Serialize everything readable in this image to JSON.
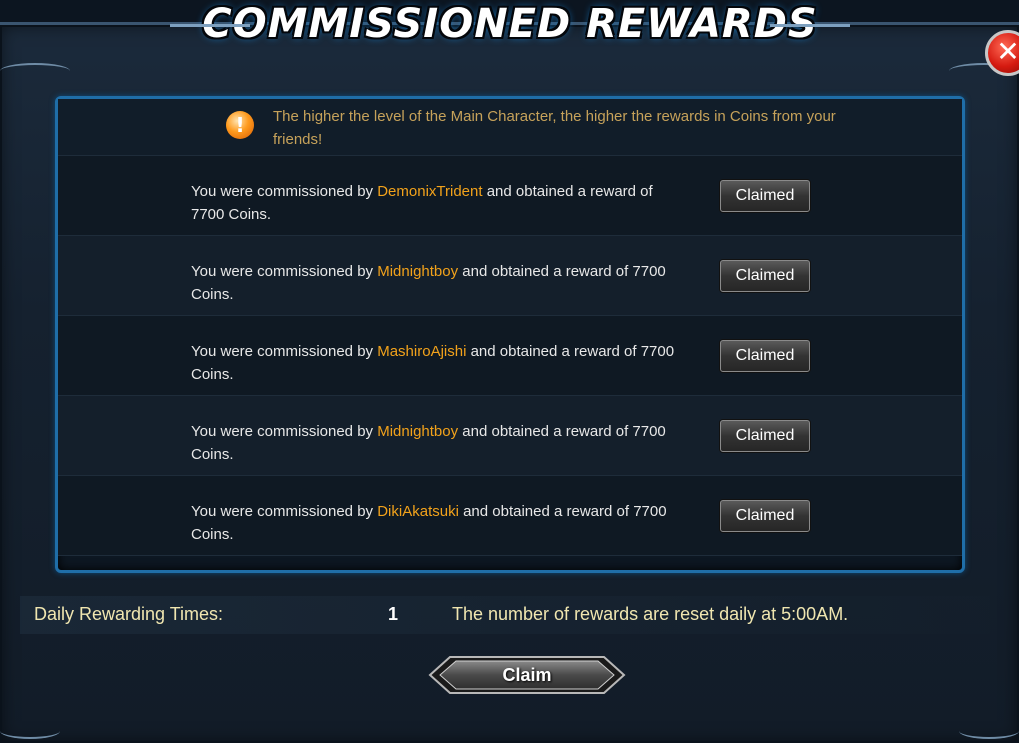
{
  "title": "COMMISSIONED REWARDS",
  "notice": {
    "text": "The higher the level of the Main Character, the higher the rewards in Coins from your friends!"
  },
  "rows": [
    {
      "prefix": "You were commissioned by",
      "name": "DemonixTrident",
      "suffix": "and obtained a reward of 7700 Coins.",
      "button": "Claimed"
    },
    {
      "prefix": "You were commissioned by",
      "name": "Midnightboy",
      "suffix": "and obtained a reward of 7700 Coins.",
      "button": "Claimed"
    },
    {
      "prefix": "You were commissioned by",
      "name": "MashiroAjishi",
      "suffix": "and obtained a reward of 7700 Coins.",
      "button": "Claimed"
    },
    {
      "prefix": "You were commissioned by",
      "name": "Midnightboy",
      "suffix": "and obtained a reward of 7700 Coins.",
      "button": "Claimed"
    },
    {
      "prefix": "You were commissioned by",
      "name": "DikiAkatsuki",
      "suffix": "and obtained a reward of 7700 Coins.",
      "button": "Claimed"
    }
  ],
  "daily": {
    "label": "Daily Rewarding Times:",
    "count": "1",
    "note": "The number of rewards are reset daily at 5:00AM."
  },
  "claim_button": "Claim",
  "close_icon": "close-icon",
  "notice_icon": "exclamation-icon",
  "colors": {
    "accent_name": "#f2a21b",
    "notice_text": "#c6a25a",
    "panel_border": "#1f6ea8",
    "close_red": "#d51a10"
  }
}
